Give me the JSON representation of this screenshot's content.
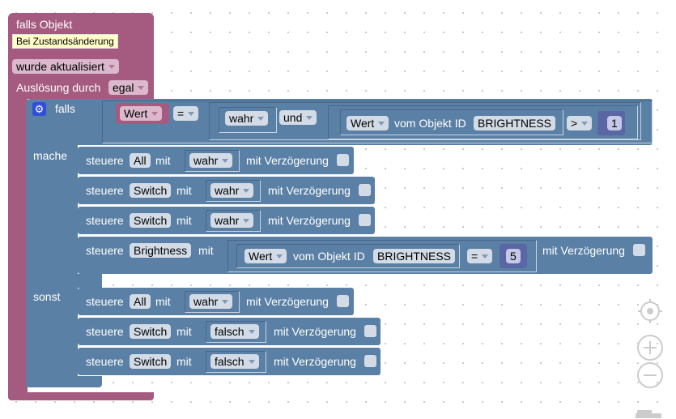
{
  "trigger": {
    "title": "falls Objekt",
    "tooltip": "Bei Zustandsänderung",
    "mode": "wurde aktualisiert",
    "trigger_label": "Auslösung durch",
    "trigger_value": "egal"
  },
  "if_block": {
    "falls": "falls",
    "mache": "mache",
    "sonst": "sonst",
    "condition": {
      "left": "Wert",
      "op": "=",
      "bool": "wahr",
      "logic": "und",
      "get_value": "Wert",
      "of_object": "vom Objekt ID",
      "object_id": "BRIGHTNESS",
      "compare": ">",
      "number": "1"
    }
  },
  "do_statements": [
    {
      "steuere": "steuere",
      "target": "All",
      "mit": "mit",
      "value": "wahr",
      "delay": "mit Verzögerung"
    },
    {
      "steuere": "steuere",
      "target": "Switch",
      "mit": "mit",
      "value": "wahr",
      "delay": "mit Verzögerung"
    },
    {
      "steuere": "steuere",
      "target": "Switch",
      "mit": "mit",
      "value": "wahr",
      "delay": "mit Verzögerung"
    },
    {
      "steuere": "steuere",
      "target": "Brightness",
      "mit": "mit",
      "get_value": "Wert",
      "of_object": "vom Objekt ID",
      "object_id": "BRIGHTNESS",
      "op": "=",
      "number": "5",
      "delay": "mit Verzögerung"
    }
  ],
  "else_statements": [
    {
      "steuere": "steuere",
      "target": "All",
      "mit": "mit",
      "value": "wahr",
      "delay": "mit Verzögerung"
    },
    {
      "steuere": "steuere",
      "target": "Switch",
      "mit": "mit",
      "value": "falsch",
      "delay": "mit Verzögerung"
    },
    {
      "steuere": "steuere",
      "target": "Switch",
      "mit": "mit",
      "value": "falsch",
      "delay": "mit Verzögerung"
    }
  ],
  "controls": {
    "icons": [
      "target-icon",
      "zoom-in-icon",
      "zoom-out-icon",
      "trash-icon"
    ]
  },
  "colors": {
    "trigger_block": "#a55b80",
    "logic_block": "#5b80a5",
    "number_block": "#5b67a5",
    "tooltip": "#ffffc7"
  }
}
